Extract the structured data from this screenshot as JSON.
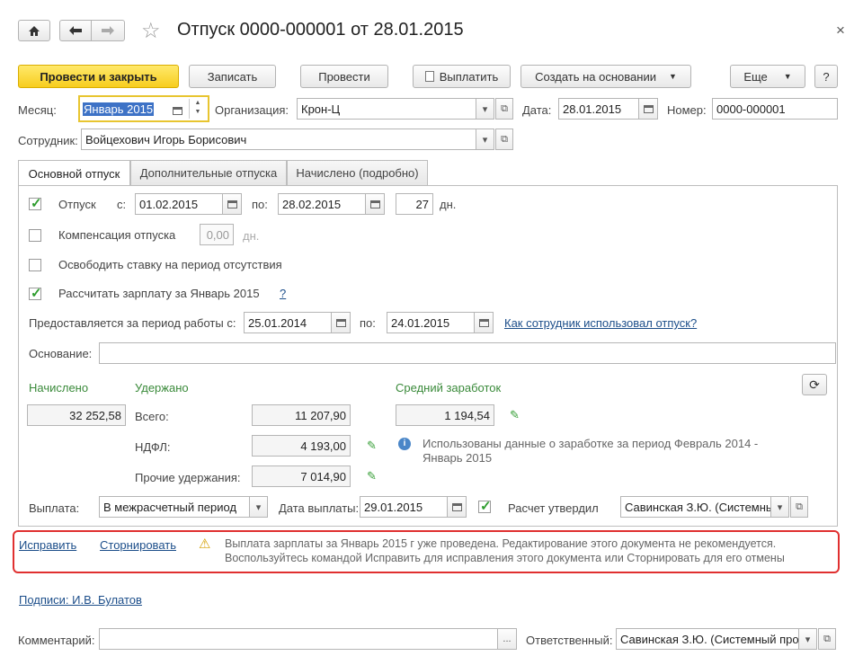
{
  "window": {
    "title": "Отпуск 0000-000001 от 28.01.2015",
    "close_glyph": "×"
  },
  "toolbar": {
    "post_close": "Провести и закрыть",
    "save": "Записать",
    "post": "Провести",
    "pay": "Выплатить",
    "create_based": "Создать на основании",
    "more": "Еще",
    "help": "?"
  },
  "header": {
    "month_label": "Месяц:",
    "month_value": "Январь 2015",
    "org_label": "Организация:",
    "org_value": "Крон-Ц",
    "date_label": "Дата:",
    "date_value": "28.01.2015",
    "number_label": "Номер:",
    "number_value": "0000-000001",
    "employee_label": "Сотрудник:",
    "employee_value": "Войцехович Игорь Борисович"
  },
  "tabs": [
    {
      "label": "Основной отпуск"
    },
    {
      "label": "Дополнительные отпуска"
    },
    {
      "label": "Начислено (подробно)"
    }
  ],
  "main": {
    "vacation_label": "Отпуск",
    "from_label": "с:",
    "from_value": "01.02.2015",
    "to_label": "по:",
    "to_value": "28.02.2015",
    "days_value": "27",
    "days_label": "дн.",
    "compensation_label": "Компенсация отпуска",
    "compensation_value": "0,00",
    "compensation_days": "дн.",
    "free_rate_label": "Освободить ставку на период отсутствия",
    "calc_salary_label": "Рассчитать зарплату за Январь 2015",
    "help_q": "?",
    "period_label": "Предоставляется за период работы с:",
    "period_from": "25.01.2014",
    "period_to_label": "по:",
    "period_to": "24.01.2015",
    "how_used_link": "Как сотрудник использовал отпуск?",
    "basis_label": "Основание:",
    "basis_value": ""
  },
  "amounts": {
    "accrued_header": "Начислено",
    "accrued_value": "32 252,58",
    "withheld_header": "Удержано",
    "total_label": "Всего:",
    "total_value": "11 207,90",
    "ndfl_label": "НДФЛ:",
    "ndfl_value": "4 193,00",
    "other_label": "Прочие удержания:",
    "other_value": "7 014,90",
    "avg_header": "Средний заработок",
    "avg_value": "1 194,54",
    "info_text_1": "Использованы данные о заработке за период Февраль 2014 -",
    "info_text_2": "Январь 2015"
  },
  "payment": {
    "payout_label": "Выплата:",
    "payout_value": "В межрасчетный период",
    "pay_date_label": "Дата выплаты:",
    "pay_date_value": "29.01.2015",
    "approved_label": "Расчет утвердил",
    "approved_value": "Савинская З.Ю. (Системны"
  },
  "warning": {
    "fix_link": "Исправить",
    "reverse_link": "Сторнировать",
    "text_1": "Выплата зарплаты за Январь 2015 г уже проведена. Редактирование этого документа не рекомендуется.",
    "text_2": "Воспользуйтесь командой Исправить для исправления этого документа или Сторнировать для его отмены"
  },
  "footer": {
    "signatures_link": "Подписи: И.В. Булатов",
    "comment_label": "Комментарий:",
    "comment_value": "",
    "comment_btn": "...",
    "responsible_label": "Ответственный:",
    "responsible_value": "Савинская З.Ю. (Системный про"
  },
  "colors": {
    "primary_button": "#f7cd1e",
    "green_text": "#3a8a3a",
    "link": "#1c4e8a",
    "warning_border": "#e03030"
  }
}
